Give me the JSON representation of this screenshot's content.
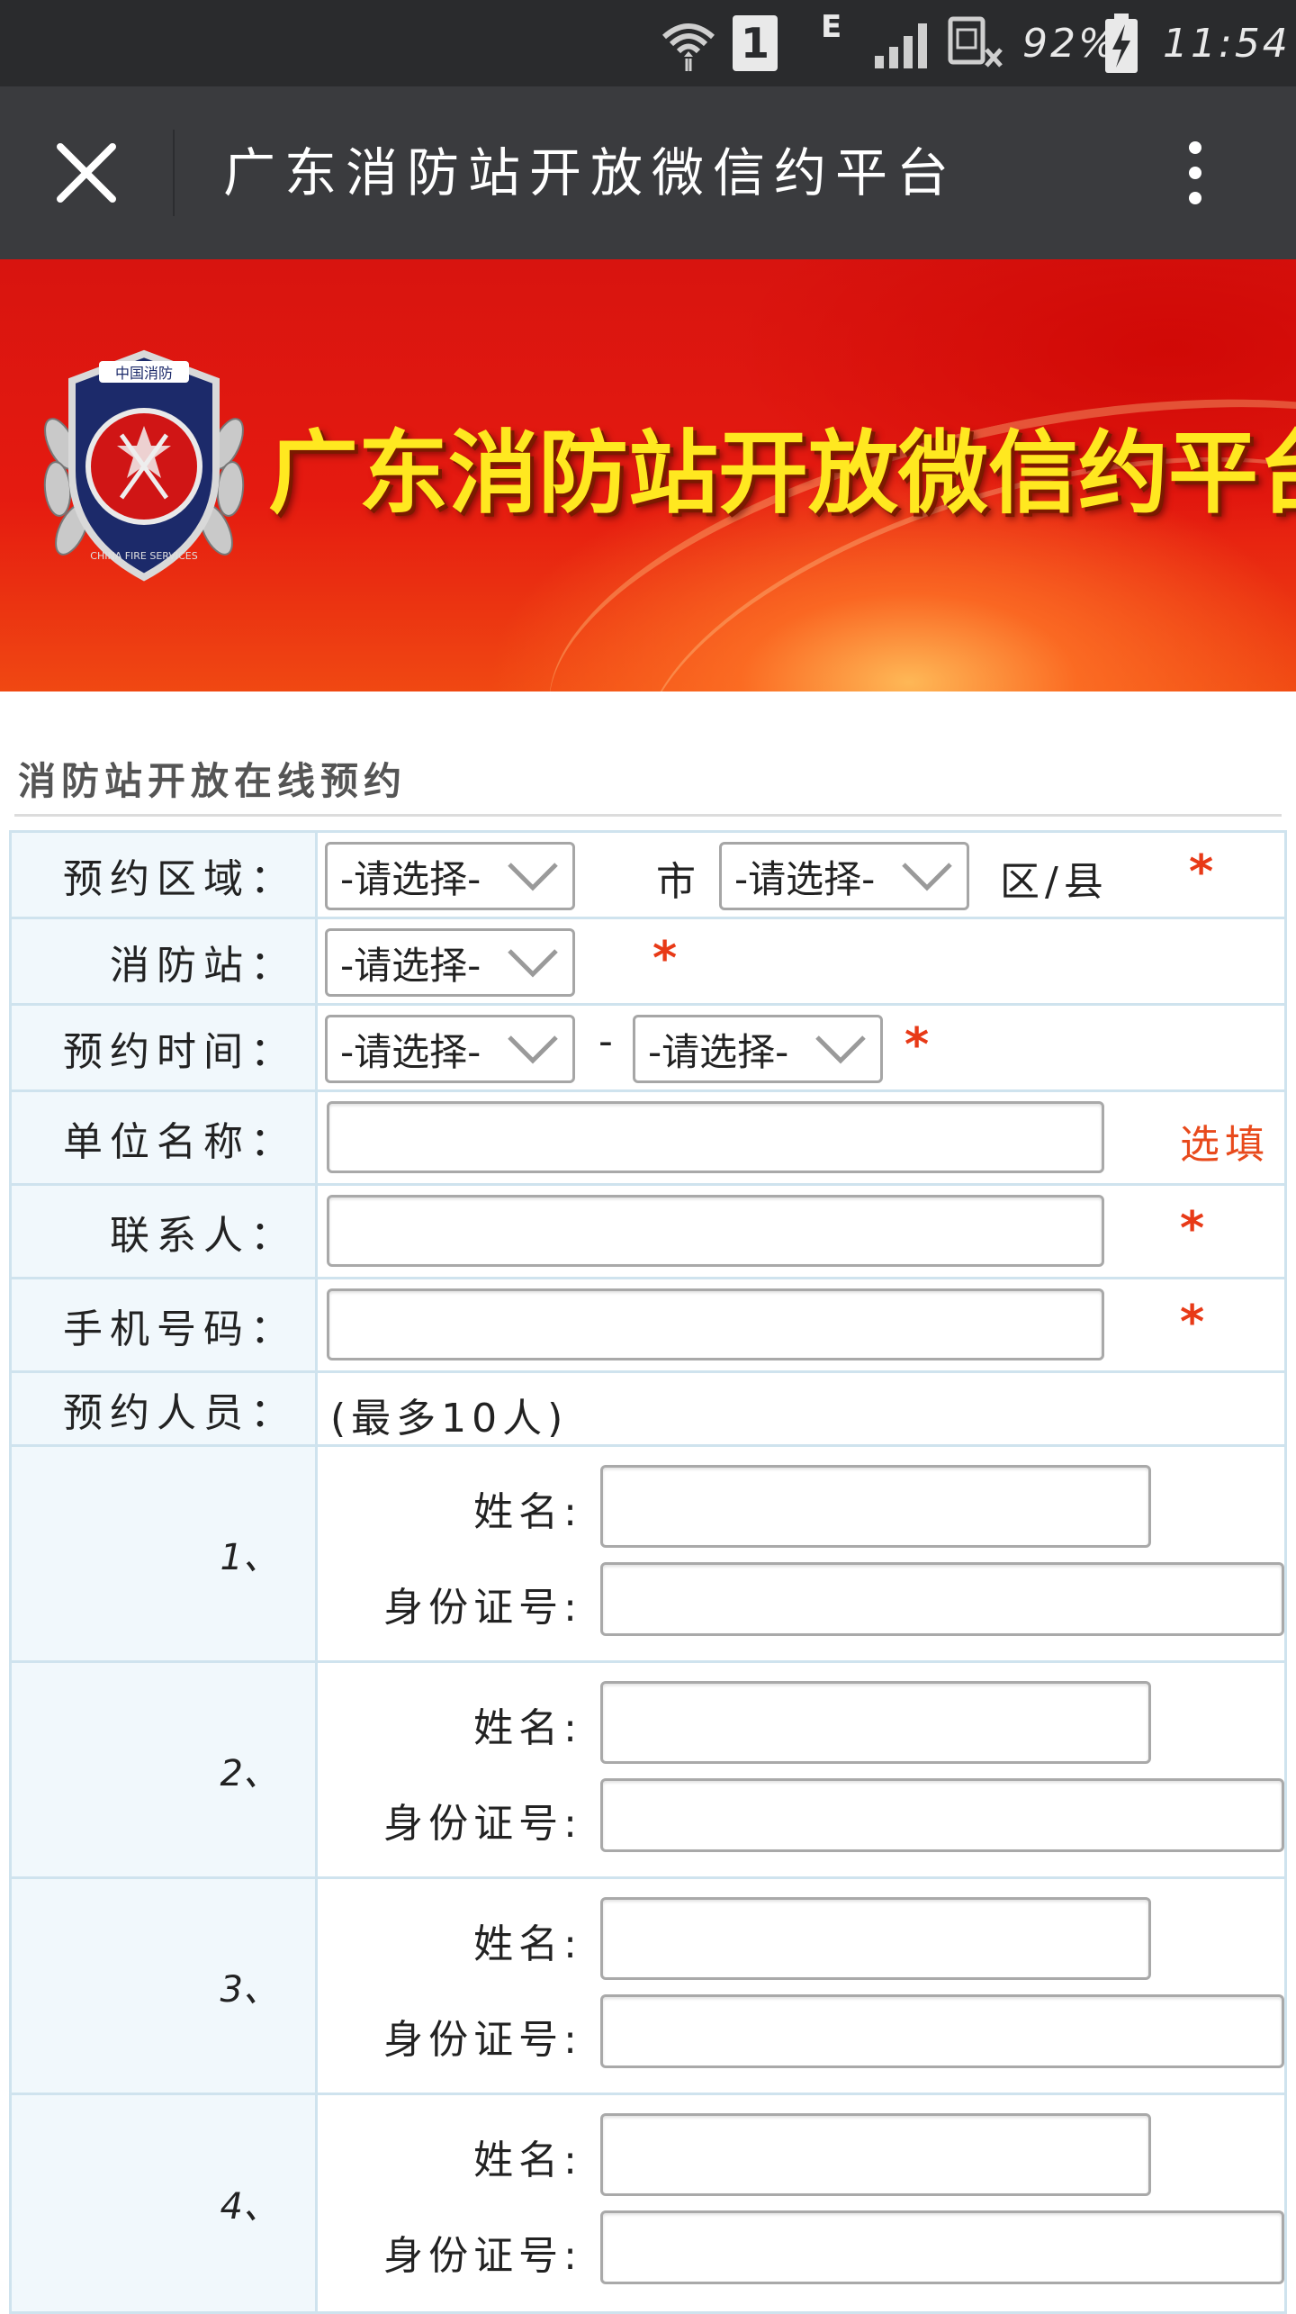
{
  "status_bar": {
    "network_type": "E",
    "sim_slot": "1",
    "battery": "92%",
    "time": "11:54",
    "icons": [
      "wifi-icon",
      "sim-1-icon",
      "network-e-icon",
      "signal-icon",
      "no-sim-icon",
      "battery-charging-icon"
    ]
  },
  "titlebar": {
    "title": "广东消防站开放微信约平台",
    "close_icon": "close-icon",
    "menu_icon": "more-vertical-icon"
  },
  "banner": {
    "title": "广东消防站开放微信约平台",
    "emblem_text_top": "中国消防",
    "emblem_text_ring": "CHINA FIRE SERVICES"
  },
  "section_title": "消防站开放在线预约",
  "form": {
    "region": {
      "label": "预约区域：",
      "city_select": "-请选择-",
      "city_unit": "市",
      "district_select": "-请选择-",
      "district_unit": "区/县",
      "required": "*"
    },
    "station": {
      "label": "消防站：",
      "select": "-请选择-",
      "required": "*"
    },
    "time": {
      "label": "预约时间：",
      "start_select": "-请选择-",
      "separator": "-",
      "end_select": "-请选择-",
      "required": "*"
    },
    "company": {
      "label": "单位名称：",
      "value": "",
      "optional": "选填"
    },
    "contact": {
      "label": "联系人：",
      "value": "",
      "required": "*"
    },
    "phone": {
      "label": "手机号码：",
      "value": "",
      "required": "*"
    },
    "people": {
      "label": "预约人员：",
      "note": "(最多10人)"
    },
    "persons": [
      {
        "index": "1、",
        "name_label": "姓名:",
        "id_label": "身份证号:",
        "name": "",
        "id_number": ""
      },
      {
        "index": "2、",
        "name_label": "姓名:",
        "id_label": "身份证号:",
        "name": "",
        "id_number": ""
      },
      {
        "index": "3、",
        "name_label": "姓名:",
        "id_label": "身份证号:",
        "name": "",
        "id_number": ""
      },
      {
        "index": "4、",
        "name_label": "姓名:",
        "id_label": "身份证号:",
        "name": "",
        "id_number": ""
      }
    ]
  },
  "colors": {
    "status_bar_bg": "#2a2b2d",
    "title_bar_bg": "#3a3b3e",
    "banner_red": "#e51a10",
    "banner_title_yellow": "#ffe820",
    "required_star": "#e83a17",
    "label_cell_bg": "#f1f8fc",
    "grid_border": "#cfe3ee"
  }
}
